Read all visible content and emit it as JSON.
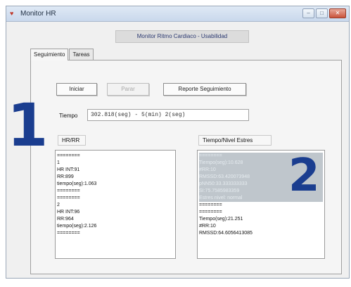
{
  "window": {
    "title": "Monitor HR",
    "app_icon": "heart-monitor-icon",
    "controls": [
      "minimize-icon",
      "maximize-icon",
      "close-icon"
    ]
  },
  "header": {
    "title": "Monitor Ritmo Cardiaco - Usabilidad"
  },
  "tabs": [
    {
      "label": "Seguimiento",
      "active": true
    },
    {
      "label": "Tareas",
      "active": false
    }
  ],
  "toolbar": {
    "start_label": "Iniciar",
    "stop_label": "Parar",
    "report_label": "Reporte Seguimiento"
  },
  "annotations": {
    "one": "1",
    "two": "2"
  },
  "time": {
    "label": "Tiempo",
    "value": "302.818(seg) - 5(min) 2(seg)"
  },
  "hr_panel": {
    "label": "HR/RR",
    "lines": [
      "========",
      "1",
      "HR INT:91",
      "RR:899",
      "tiempo(seg):1.063",
      "========",
      "========",
      "2",
      "HR INT:96",
      "RR:964",
      "tiempo(seg):2.126",
      "========"
    ]
  },
  "stress_panel": {
    "label": "Tiempo/Nivel Estres",
    "selected_lines": [
      "========",
      "Tiempo(seg):10.628",
      "#RR:10",
      "RMSSD:63.420073948",
      "pNN50:33.333333333",
      "SI:75.7585983359",
      "Estres nivel: normal"
    ],
    "lines": [
      "========",
      "========",
      "Tiempo(seg):21.251",
      "#RR:10",
      "RMSSD:64.6056413085"
    ]
  },
  "colors": {
    "annotation_blue": "#1a3d8f",
    "header_text": "#2a3870",
    "selection_bg": "#bfc6cc"
  }
}
